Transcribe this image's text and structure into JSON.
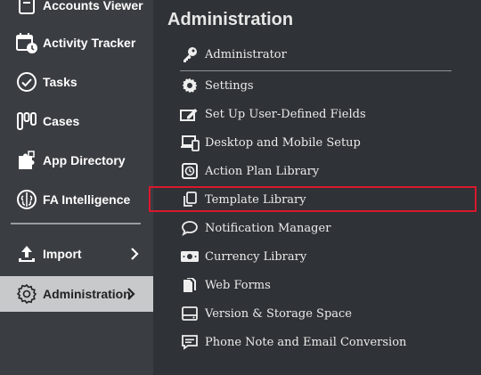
{
  "sidebar": {
    "items": [
      {
        "label": "Accounts Viewer",
        "icon": "accounts-viewer-icon"
      },
      {
        "label": "Activity Tracker",
        "icon": "calendar-clock-icon"
      },
      {
        "label": "Tasks",
        "icon": "check-circle-icon"
      },
      {
        "label": "Cases",
        "icon": "cases-icon"
      },
      {
        "label": "App Directory",
        "icon": "puzzle-icon"
      },
      {
        "label": "FA Intelligence",
        "icon": "brain-icon"
      },
      {
        "label": "Import",
        "icon": "upload-icon"
      },
      {
        "label": "Administration",
        "icon": "gear-icon"
      }
    ]
  },
  "panel": {
    "title": "Administration",
    "items": [
      {
        "label": "Administrator",
        "icon": "key-icon"
      },
      {
        "label": "Settings",
        "icon": "gear-icon"
      },
      {
        "label": "Set Up User-Defined Fields",
        "icon": "edit-fields-icon"
      },
      {
        "label": "Desktop and Mobile Setup",
        "icon": "desktop-mobile-icon"
      },
      {
        "label": "Action Plan Library",
        "icon": "action-plan-icon"
      },
      {
        "label": "Template Library",
        "icon": "copy-icon"
      },
      {
        "label": "Notification Manager",
        "icon": "chat-bubble-icon"
      },
      {
        "label": "Currency Library",
        "icon": "money-icon"
      },
      {
        "label": "Web Forms",
        "icon": "forms-icon"
      },
      {
        "label": "Version & Storage Space",
        "icon": "storage-icon"
      },
      {
        "label": "Phone Note and Email Conversion",
        "icon": "phone-note-icon"
      }
    ]
  },
  "colors": {
    "sidebar_bg": "#3a3d41",
    "panel_bg": "#2f3236",
    "active_bg": "#c7c9cb",
    "highlight_border": "#d9182e"
  }
}
